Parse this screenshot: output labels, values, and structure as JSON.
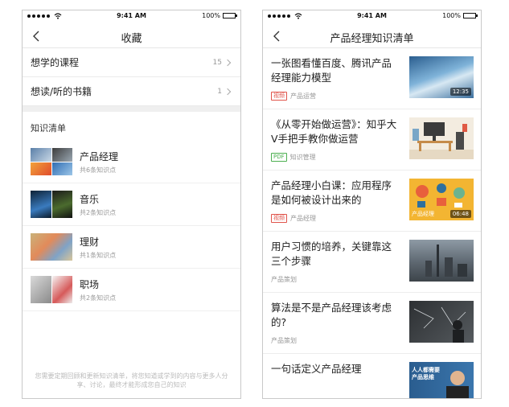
{
  "status": {
    "time": "9:41 AM",
    "battery": "100%"
  },
  "left": {
    "title": "收藏",
    "favorites": [
      {
        "label": "想学的课程",
        "count": "15"
      },
      {
        "label": "想读/听的书籍",
        "count": "1"
      }
    ],
    "section_title": "知识清单",
    "topics": [
      {
        "name": "产品经理",
        "sub": "共6条知识点"
      },
      {
        "name": "音乐",
        "sub": "共2条知识点"
      },
      {
        "name": "理财",
        "sub": "共1条知识点"
      },
      {
        "name": "职场",
        "sub": "共2条知识点"
      }
    ],
    "footer": "您需要定期回顾和更新知识清单，将您知道或学到的内容与更多人分享、讨论，最终才能形成您自己的知识"
  },
  "right": {
    "title": "产品经理知识清单",
    "articles": [
      {
        "title": "一张图看懂百度、腾讯产品经理能力模型",
        "tag": "视频",
        "category": "产品运营",
        "duration": "12:35",
        "thumb_label": ""
      },
      {
        "title": "《从零开始做运营》：知乎大V手把手教你做运营",
        "tag": "PDF",
        "category": "知识管理",
        "duration": "",
        "thumb_label": ""
      },
      {
        "title": "产品经理小白课：应用程序是如何被设计出来的",
        "tag": "视频",
        "category": "产品经理",
        "duration": "06:48",
        "thumb_label": "产品经理"
      },
      {
        "title": "用户习惯的培养，关键靠这三个步骤",
        "tag": "",
        "category": "产品策划",
        "duration": "",
        "thumb_label": ""
      },
      {
        "title": "算法是不是产品经理该考虑的?",
        "tag": "",
        "category": "产品策划",
        "duration": "",
        "thumb_label": ""
      },
      {
        "title": "一句话定义产品经理",
        "tag": "",
        "category": "",
        "duration": "",
        "thumb_label": "人人都需要产品思维"
      }
    ]
  }
}
